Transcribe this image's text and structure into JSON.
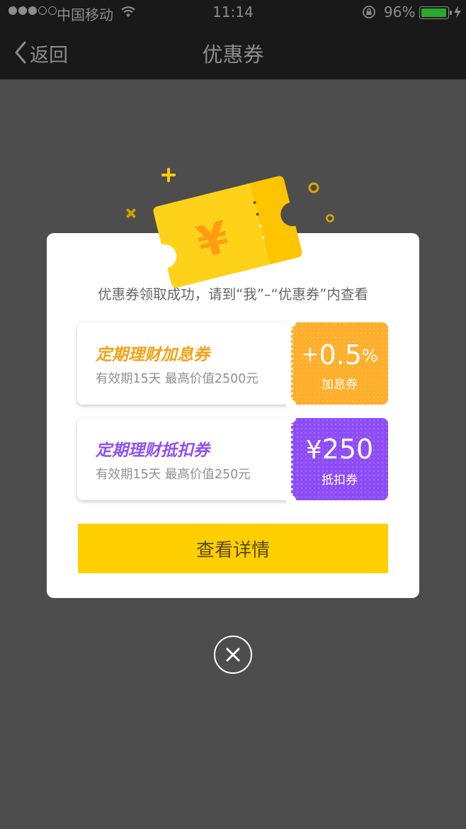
{
  "status_bar": {
    "carrier": "中国移动",
    "time": "11:14",
    "battery_percent": "96%",
    "battery_level": 0.96,
    "signal_bars_filled": 3,
    "signal_bars_total": 5
  },
  "nav": {
    "back_label": "返回",
    "title": "优惠券"
  },
  "dialog": {
    "message": "优惠券领取成功，请到“我”–“优惠券”内查看",
    "ticket_symbol": "¥",
    "coupons": [
      {
        "title": "定期理财加息券",
        "desc": "有效期15天  最高价值2500元",
        "value_prefix": "+",
        "value_number": "0.5",
        "value_suffix": "%",
        "value_label": "加息券",
        "accent_color": "#ffae2a",
        "title_color": "#f7a114"
      },
      {
        "title": "定期理财抵扣券",
        "desc": "有效期15天  最高价值250元",
        "value_prefix": "¥",
        "value_number": "250",
        "value_suffix": "",
        "value_label": "抵扣券",
        "accent_color": "#8d4cf5",
        "title_color": "#8d52f2"
      }
    ],
    "detail_button": "查看详情",
    "primary_color": "#ffcf00"
  },
  "icons": {
    "back": "chevron-left-icon",
    "wifi": "wifi-icon",
    "lock": "rotation-lock-icon",
    "battery": "battery-icon",
    "charging": "charging-bolt-icon",
    "close": "close-icon",
    "illustration": "coupon-ticket-illustration"
  }
}
